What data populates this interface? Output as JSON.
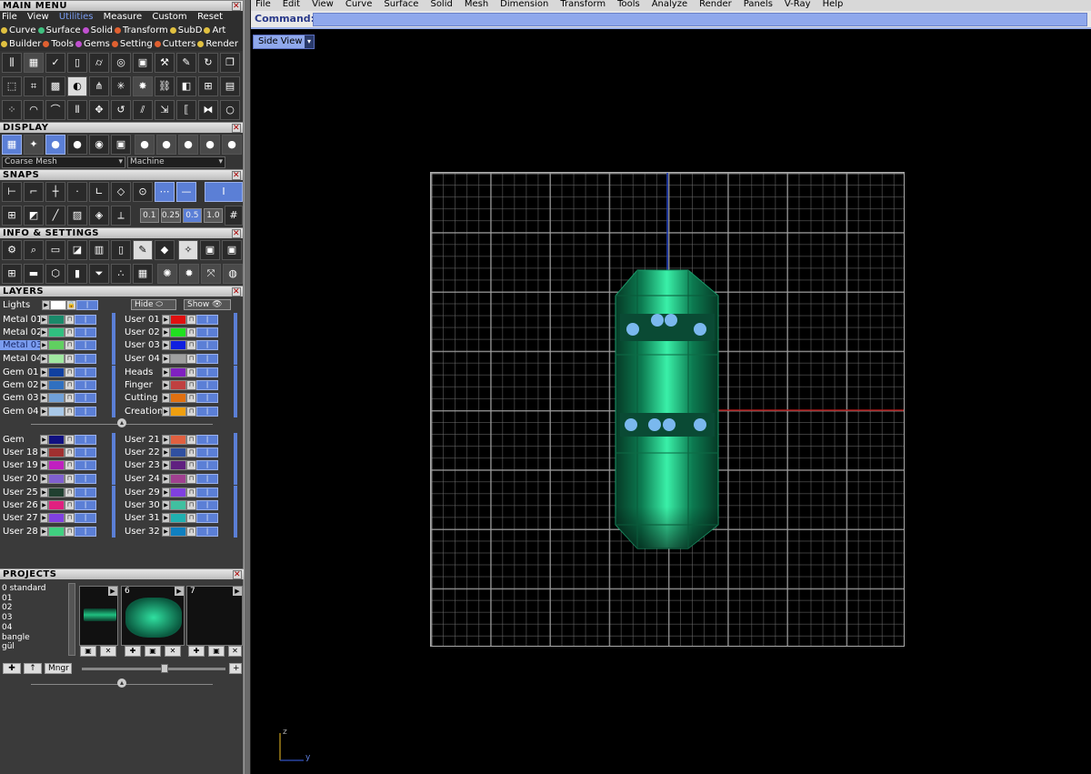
{
  "main_menu": {
    "title": "MAIN MENU",
    "menu": [
      "File",
      "View",
      "Utilities",
      "Measure",
      "Custom"
    ],
    "selected": "Utilities",
    "reset": "Reset",
    "row1": [
      {
        "label": "Curve",
        "color": "#e0c040"
      },
      {
        "label": "Surface",
        "color": "#40c080"
      },
      {
        "label": "Solid",
        "color": "#c050d0"
      },
      {
        "label": "Transform",
        "color": "#e06030"
      },
      {
        "label": "SubD",
        "color": "#e0c040"
      },
      {
        "label": "Art",
        "color": "#e0c040"
      }
    ],
    "row2": [
      {
        "label": "Builder",
        "color": "#e0c040"
      },
      {
        "label": "Tools",
        "color": "#e06030"
      },
      {
        "label": "Gems",
        "color": "#c050d0"
      },
      {
        "label": "Setting",
        "color": "#e06030"
      },
      {
        "label": "Cutters",
        "color": "#e06030"
      },
      {
        "label": "Render",
        "color": "#e0c040"
      }
    ]
  },
  "display": {
    "title": "DISPLAY",
    "mesh_select": "Coarse Mesh",
    "material_select": "Machine"
  },
  "snaps": {
    "title": "SNAPS",
    "values": [
      "0.1",
      "0.25",
      "0.5",
      "1.0"
    ],
    "active": "0.5"
  },
  "info": {
    "title": "INFO & SETTINGS"
  },
  "layers": {
    "title": "LAYERS",
    "lights": "Lights",
    "hide": "Hide",
    "show": "Show",
    "groups": [
      {
        "left": [
          {
            "name": "Metal 01",
            "color": "#1a8a6a"
          },
          {
            "name": "Metal 02",
            "color": "#30c080"
          },
          {
            "name": "Metal 03",
            "color": "#60d060",
            "selected": true
          },
          {
            "name": "Metal 04",
            "color": "#a0e8a0"
          }
        ],
        "right": [
          {
            "name": "User 01",
            "color": "#e01010"
          },
          {
            "name": "User 02",
            "color": "#20e020"
          },
          {
            "name": "User 03",
            "color": "#1020e0"
          },
          {
            "name": "User 04",
            "color": "#a0a0a0"
          }
        ]
      },
      {
        "left": [
          {
            "name": "Gem 01",
            "color": "#1040a0"
          },
          {
            "name": "Gem 02",
            "color": "#3070c0"
          },
          {
            "name": "Gem 03",
            "color": "#70a0d8"
          },
          {
            "name": "Gem 04",
            "color": "#a8c8e8"
          }
        ],
        "right": [
          {
            "name": "Heads",
            "color": "#8020c0"
          },
          {
            "name": "Finger",
            "color": "#c04040"
          },
          {
            "name": "Cutting",
            "color": "#e07010"
          },
          {
            "name": "Creation",
            "color": "#f0a010"
          }
        ]
      },
      {
        "left": [
          {
            "name": "Gem",
            "color": "#101080"
          },
          {
            "name": "User 18",
            "color": "#a03030"
          },
          {
            "name": "User 19",
            "color": "#c020c0"
          },
          {
            "name": "User 20",
            "color": "#8060d0"
          }
        ],
        "right": [
          {
            "name": "User 21",
            "color": "#e06040"
          },
          {
            "name": "User 22",
            "color": "#3050a0"
          },
          {
            "name": "User 23",
            "color": "#602080"
          },
          {
            "name": "User 24",
            "color": "#a04090"
          }
        ]
      },
      {
        "left": [
          {
            "name": "User 25",
            "color": "#204030"
          },
          {
            "name": "User 26",
            "color": "#e02080"
          },
          {
            "name": "User 27",
            "color": "#8040e0"
          },
          {
            "name": "User 28",
            "color": "#40d080"
          }
        ],
        "right": [
          {
            "name": "User 29",
            "color": "#8040e0"
          },
          {
            "name": "User 30",
            "color": "#40c0a0"
          },
          {
            "name": "User 31",
            "color": "#20b0b0"
          },
          {
            "name": "User 32",
            "color": "#1080c0"
          }
        ]
      }
    ]
  },
  "projects": {
    "title": "PROJECTS",
    "items": [
      "0 standard",
      "01",
      "02",
      "03",
      "04",
      "bangle",
      "gül"
    ],
    "thumbs": [
      "",
      "6",
      "7"
    ],
    "mngr": "Mngr"
  },
  "viewport": {
    "menus": [
      "File",
      "Edit",
      "View",
      "Curve",
      "Surface",
      "Solid",
      "Mesh",
      "Dimension",
      "Transform",
      "Tools",
      "Analyze",
      "Render",
      "Panels",
      "V-Ray",
      "Help"
    ],
    "command_label": "Command:",
    "view_name": "Side View",
    "axis_z": "z",
    "axis_y": "y"
  }
}
